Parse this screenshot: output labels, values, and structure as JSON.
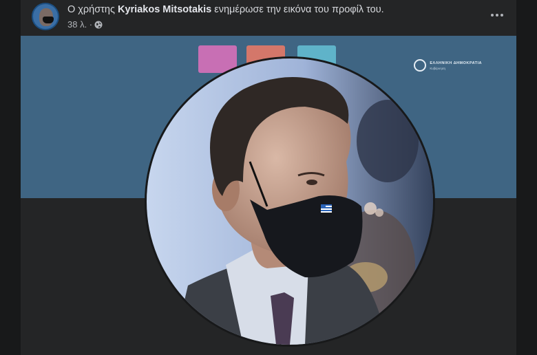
{
  "post": {
    "prefix": "Ο χρήστης ",
    "author": "Kyriakos Mitsotakis",
    "action": " ενημέρωσε την εικόνα του προφίλ του.",
    "time": "38 λ. ·",
    "privacy_icon": "globe-icon",
    "menu_icon": "more-options-icon"
  },
  "cover": {
    "logo_line1": "ΕΛΛΗΝΙΚΗ ΔΗΜΟΚΡΑΤΙΑ",
    "logo_line2": "Κυβέρνηση"
  },
  "colors": {
    "card_bg": "#242526",
    "page_bg": "#18191a",
    "cover_bg": "#3f6583",
    "text_primary": "#e4e6eb",
    "text_secondary": "#b0b3b8"
  }
}
